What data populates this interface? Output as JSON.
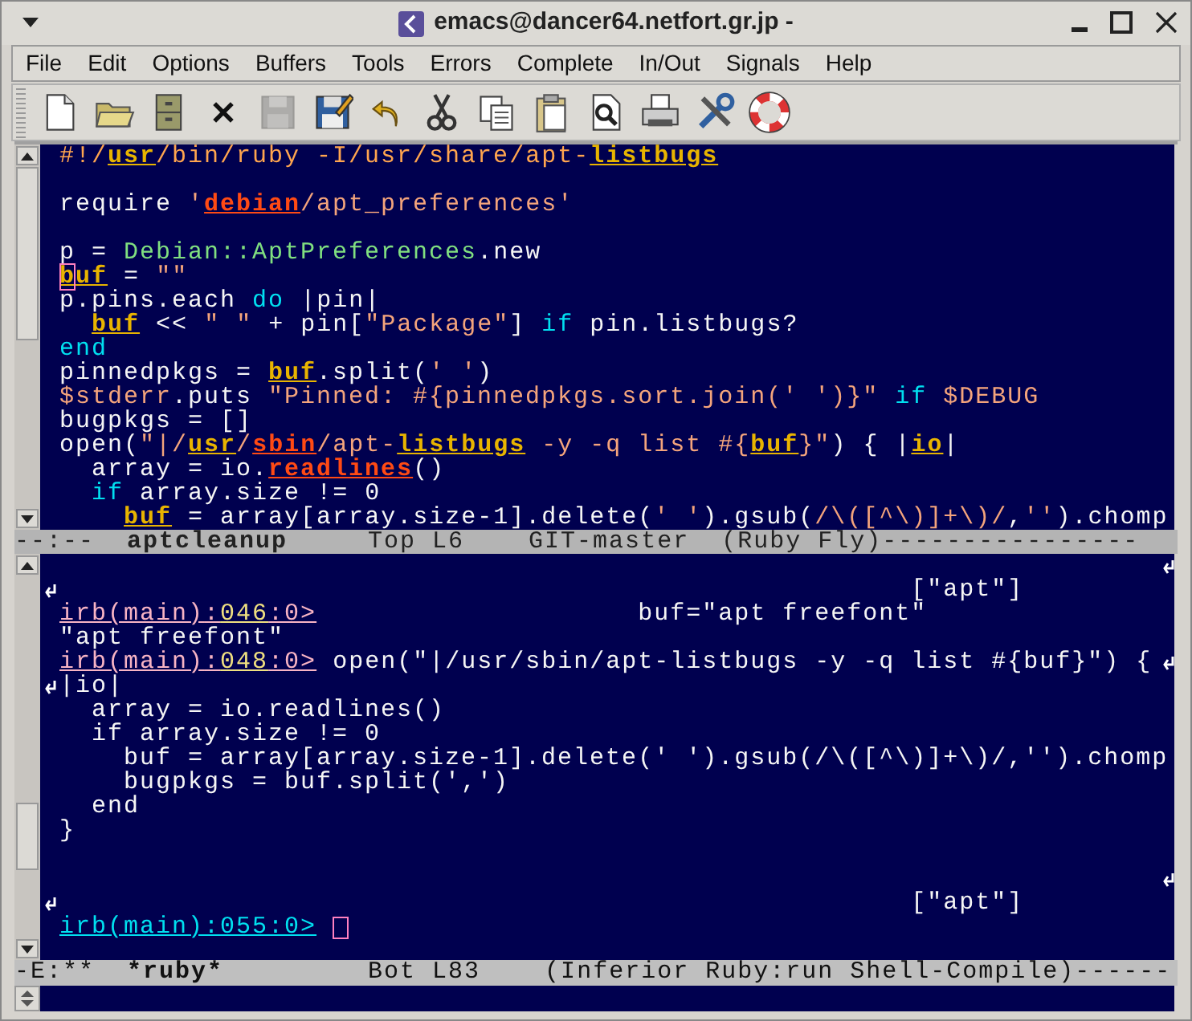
{
  "window": {
    "title": "emacs@dancer64.netfort.gr.jp -"
  },
  "menu": [
    "File",
    "Edit",
    "Options",
    "Buffers",
    "Tools",
    "Errors",
    "Complete",
    "In/Out",
    "Signals",
    "Help"
  ],
  "toolbar": [
    {
      "disabled": false
    },
    {
      "disabled": false
    },
    {
      "disabled": false
    },
    {
      "disabled": false
    },
    {
      "disabled": true
    },
    {
      "disabled": false
    },
    {
      "disabled": false
    },
    {
      "disabled": false
    },
    {
      "disabled": false
    },
    {
      "disabled": false
    },
    {
      "disabled": false
    },
    {
      "disabled": false
    },
    {
      "disabled": false
    },
    {
      "disabled": false
    }
  ],
  "upper_window": {
    "lines": [
      {
        "kind": "code",
        "segments": [
          {
            "text": "#!/",
            "kind": "comment"
          },
          {
            "text": "usr",
            "kind": "ref"
          },
          {
            "text": "/bin/ruby -I/usr/share/apt-",
            "kind": "comment"
          },
          {
            "text": "listbugs",
            "kind": "ref"
          }
        ]
      },
      {
        "kind": "blank"
      },
      {
        "kind": "code",
        "segments": [
          {
            "text": "require ",
            "kind": "plain"
          },
          {
            "text": "'",
            "kind": "string"
          },
          {
            "text": "debian",
            "kind": "warn"
          },
          {
            "text": "/apt_preferences'",
            "kind": "string"
          }
        ]
      },
      {
        "kind": "blank"
      },
      {
        "kind": "code",
        "segments": [
          {
            "text": "p = ",
            "kind": "plain"
          },
          {
            "text": "Debian::AptPreferences",
            "kind": "type"
          },
          {
            "text": ".new",
            "kind": "plain"
          }
        ]
      },
      {
        "kind": "code",
        "segments": [
          {
            "text": "b",
            "kind": "ref",
            "cursor": true
          },
          {
            "text": "uf",
            "kind": "ref"
          },
          {
            "text": " = ",
            "kind": "plain"
          },
          {
            "text": "\"\"",
            "kind": "string"
          }
        ]
      },
      {
        "kind": "code",
        "segments": [
          {
            "text": "p.pins.each ",
            "kind": "plain"
          },
          {
            "text": "do",
            "kind": "keyword"
          },
          {
            "text": " |pin|",
            "kind": "plain"
          }
        ]
      },
      {
        "kind": "code",
        "segments": [
          {
            "text": "  buf",
            "kind": "ref"
          },
          {
            "text": " << ",
            "kind": "plain"
          },
          {
            "text": "\" \"",
            "kind": "string"
          },
          {
            "text": " + pin[",
            "kind": "plain"
          },
          {
            "text": "\"Package\"",
            "kind": "string"
          },
          {
            "text": "] ",
            "kind": "plain"
          },
          {
            "text": "if",
            "kind": "keyword"
          },
          {
            "text": " pin.listbugs?",
            "kind": "plain"
          }
        ]
      },
      {
        "kind": "code",
        "segments": [
          {
            "text": "end",
            "kind": "keyword"
          }
        ]
      },
      {
        "kind": "code",
        "segments": [
          {
            "text": "pinnedpkgs = ",
            "kind": "plain"
          },
          {
            "text": "buf",
            "kind": "ref"
          },
          {
            "text": ".split(",
            "kind": "plain"
          },
          {
            "text": "' '",
            "kind": "string"
          },
          {
            "text": ")",
            "kind": "plain"
          }
        ]
      },
      {
        "kind": "code",
        "segments": [
          {
            "text": "$stderr",
            "kind": "string"
          },
          {
            "text": ".puts ",
            "kind": "plain"
          },
          {
            "text": "\"Pinned: #{pinnedpkgs.sort.join(' ')}\"",
            "kind": "string"
          },
          {
            "text": " if ",
            "kind": "keyword"
          },
          {
            "text": "$DEBUG",
            "kind": "string"
          }
        ]
      },
      {
        "kind": "code",
        "segments": [
          {
            "text": "bugpkgs = []",
            "kind": "plain"
          }
        ]
      },
      {
        "kind": "code",
        "segments": [
          {
            "text": "open(",
            "kind": "plain"
          },
          {
            "text": "\"|/",
            "kind": "string"
          },
          {
            "text": "usr",
            "kind": "ref"
          },
          {
            "text": "/",
            "kind": "string"
          },
          {
            "text": "sbin",
            "kind": "warn"
          },
          {
            "text": "/apt-",
            "kind": "string"
          },
          {
            "text": "listbugs",
            "kind": "ref"
          },
          {
            "text": " -y -q list #{",
            "kind": "string"
          },
          {
            "text": "buf",
            "kind": "ref"
          },
          {
            "text": "}\"",
            "kind": "string"
          },
          {
            "text": ") { |",
            "kind": "plain"
          },
          {
            "text": "io",
            "kind": "ref"
          },
          {
            "text": "|",
            "kind": "plain"
          }
        ]
      },
      {
        "kind": "code",
        "segments": [
          {
            "text": "  array = io.",
            "kind": "plain"
          },
          {
            "text": "readlines",
            "kind": "warn"
          },
          {
            "text": "()",
            "kind": "plain"
          }
        ]
      },
      {
        "kind": "code",
        "segments": [
          {
            "text": "  if",
            "kind": "keyword"
          },
          {
            "text": " array.size != 0",
            "kind": "plain"
          }
        ]
      },
      {
        "kind": "code",
        "segments": [
          {
            "text": "    buf",
            "kind": "ref"
          },
          {
            "text": " = array[array.size-1].delete(",
            "kind": "plain"
          },
          {
            "text": "' '",
            "kind": "string"
          },
          {
            "text": ").gsub(",
            "kind": "plain"
          },
          {
            "text": "/\\([^\\)]+\\)/",
            "kind": "string"
          },
          {
            "text": ",",
            "kind": "plain"
          },
          {
            "text": "''",
            "kind": "string"
          },
          {
            "text": ").chomp",
            "kind": "plain"
          }
        ]
      }
    ]
  },
  "upper_mode_line": [
    {
      "text": "--:--  ",
      "bold": false
    },
    {
      "text": "aptcleanup",
      "bold": true
    },
    {
      "text": "     Top L6    GIT-master  (Ruby Fly)----------------",
      "bold": false
    }
  ],
  "lower_window": {
    "lines": [
      {
        "kind": "blank",
        "wrap_left": false,
        "wrap_right": true
      },
      {
        "kind": "code",
        "wrap_left": true,
        "wrap_right": false,
        "segments": [
          {
            "text": "                                                     [\"apt\"]",
            "kind": "plain"
          }
        ]
      },
      {
        "kind": "code",
        "wrap_left": false,
        "wrap_right": false,
        "segments": [
          {
            "text": "irb(main)",
            "kind": "prompt"
          },
          {
            "text": ":",
            "kind": "prompt"
          },
          {
            "text": "046",
            "kind": "prompt-num"
          },
          {
            "text": ":0>",
            "kind": "prompt"
          },
          {
            "text": "                    buf=\"apt freefont\"",
            "kind": "plain"
          }
        ]
      },
      {
        "kind": "code",
        "wrap_left": false,
        "wrap_right": false,
        "segments": [
          {
            "text": "\"apt freefont\"",
            "kind": "plain"
          }
        ]
      },
      {
        "kind": "code",
        "wrap_left": false,
        "wrap_right": true,
        "segments": [
          {
            "text": "irb(main)",
            "kind": "prompt"
          },
          {
            "text": ":",
            "kind": "prompt"
          },
          {
            "text": "048",
            "kind": "prompt-num"
          },
          {
            "text": ":0>",
            "kind": "prompt"
          },
          {
            "text": " open(\"|/usr/sbin/apt-listbugs -y -q list #{buf}\") {",
            "kind": "plain"
          }
        ]
      },
      {
        "kind": "code",
        "wrap_left": true,
        "wrap_right": false,
        "segments": [
          {
            "text": "|io|",
            "kind": "plain"
          }
        ]
      },
      {
        "kind": "code",
        "wrap_left": false,
        "wrap_right": false,
        "segments": [
          {
            "text": "  array = io.readlines()",
            "kind": "plain"
          }
        ]
      },
      {
        "kind": "code",
        "wrap_left": false,
        "wrap_right": false,
        "segments": [
          {
            "text": "  if array.size != 0",
            "kind": "plain"
          }
        ]
      },
      {
        "kind": "code",
        "wrap_left": false,
        "wrap_right": false,
        "segments": [
          {
            "text": "    buf = array[array.size-1].delete(' ').gsub(/\\([^\\)]+\\)/,'').chomp",
            "kind": "plain"
          }
        ]
      },
      {
        "kind": "code",
        "wrap_left": false,
        "wrap_right": false,
        "segments": [
          {
            "text": "    bugpkgs = buf.split(',')",
            "kind": "plain"
          }
        ]
      },
      {
        "kind": "code",
        "wrap_left": false,
        "wrap_right": false,
        "segments": [
          {
            "text": "  end",
            "kind": "plain"
          }
        ]
      },
      {
        "kind": "code",
        "wrap_left": false,
        "wrap_right": false,
        "segments": [
          {
            "text": "}",
            "kind": "plain"
          }
        ]
      },
      {
        "kind": "blank",
        "wrap_left": false,
        "wrap_right": false
      },
      {
        "kind": "blank",
        "wrap_left": false,
        "wrap_right": true
      },
      {
        "kind": "code",
        "wrap_left": true,
        "wrap_right": false,
        "segments": [
          {
            "text": "                                                     [\"apt\"]",
            "kind": "plain"
          }
        ]
      },
      {
        "kind": "code",
        "wrap_left": false,
        "wrap_right": false,
        "cursor_at_end": true,
        "segments": [
          {
            "text": "irb(main):055:0>",
            "kind": "prompt-active"
          }
        ]
      }
    ]
  },
  "lower_mode_line": [
    {
      "text": "-E:**  ",
      "bold": false
    },
    {
      "text": "*ruby*",
      "bold": true
    },
    {
      "text": "         Bot L83    (Inferior Ruby:run Shell-Compile)------",
      "bold": false
    }
  ]
}
